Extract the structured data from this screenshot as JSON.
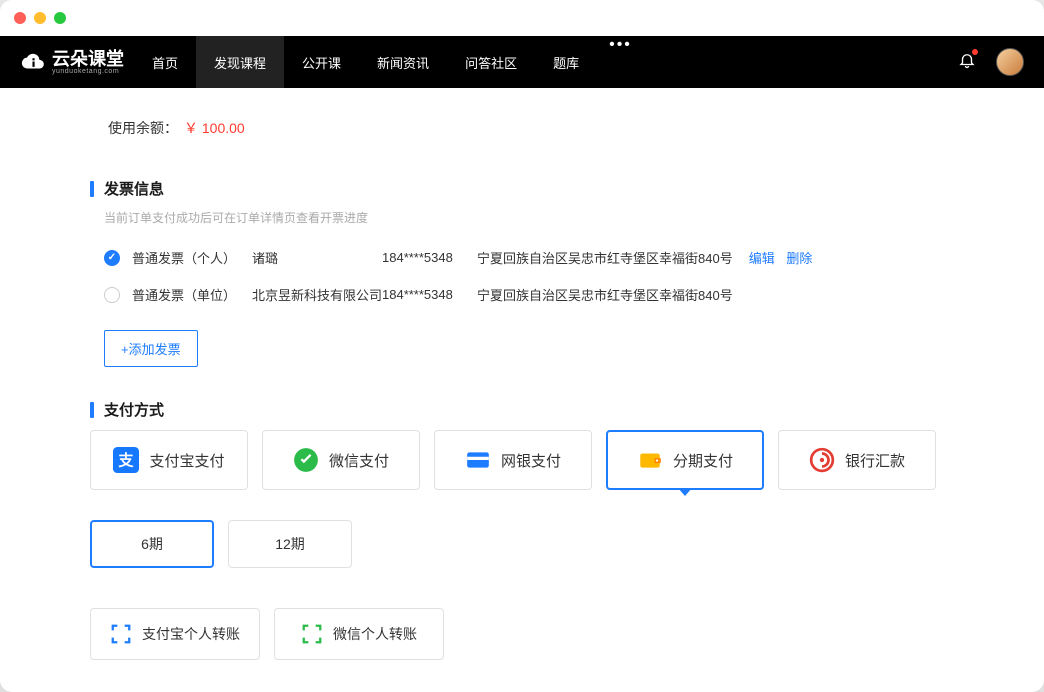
{
  "logo": {
    "name": "云朵课堂",
    "sub": "yunduoketang.com"
  },
  "nav": {
    "items": [
      "首页",
      "发现课程",
      "公开课",
      "新闻资讯",
      "问答社区",
      "题库"
    ],
    "activeIndex": 1
  },
  "balance": {
    "label": "使用余额：",
    "value": "￥ 100.00"
  },
  "invoiceSection": {
    "title": "发票信息",
    "sub": "当前订单支付成功后可在订单详情页查看开票进度",
    "rows": [
      {
        "type": "普通发票（个人）",
        "name": "诸璐",
        "phone": "184****5348",
        "addr": "宁夏回族自治区吴忠市红寺堡区幸福街840号",
        "checked": true,
        "showActions": true
      },
      {
        "type": "普通发票（单位）",
        "name": "北京昱新科技有限公司",
        "phone": "184****5348",
        "addr": "宁夏回族自治区吴忠市红寺堡区幸福街840号",
        "checked": false,
        "showActions": false
      }
    ],
    "editLabel": "编辑",
    "deleteLabel": "删除",
    "addButton": "+添加发票"
  },
  "paymentSection": {
    "title": "支付方式",
    "options": [
      {
        "label": "支付宝支付",
        "icon": "alipay"
      },
      {
        "label": "微信支付",
        "icon": "wechat"
      },
      {
        "label": "网银支付",
        "icon": "bank"
      },
      {
        "label": "分期支付",
        "icon": "installment",
        "selected": true
      },
      {
        "label": "银行汇款",
        "icon": "wire"
      }
    ],
    "installments": [
      {
        "label": "6期",
        "selected": true
      },
      {
        "label": "12期",
        "selected": false
      }
    ],
    "transfers": [
      {
        "label": "支付宝个人转账",
        "color": "#1e7cff"
      },
      {
        "label": "微信个人转账",
        "color": "#2bbb4a"
      }
    ]
  }
}
